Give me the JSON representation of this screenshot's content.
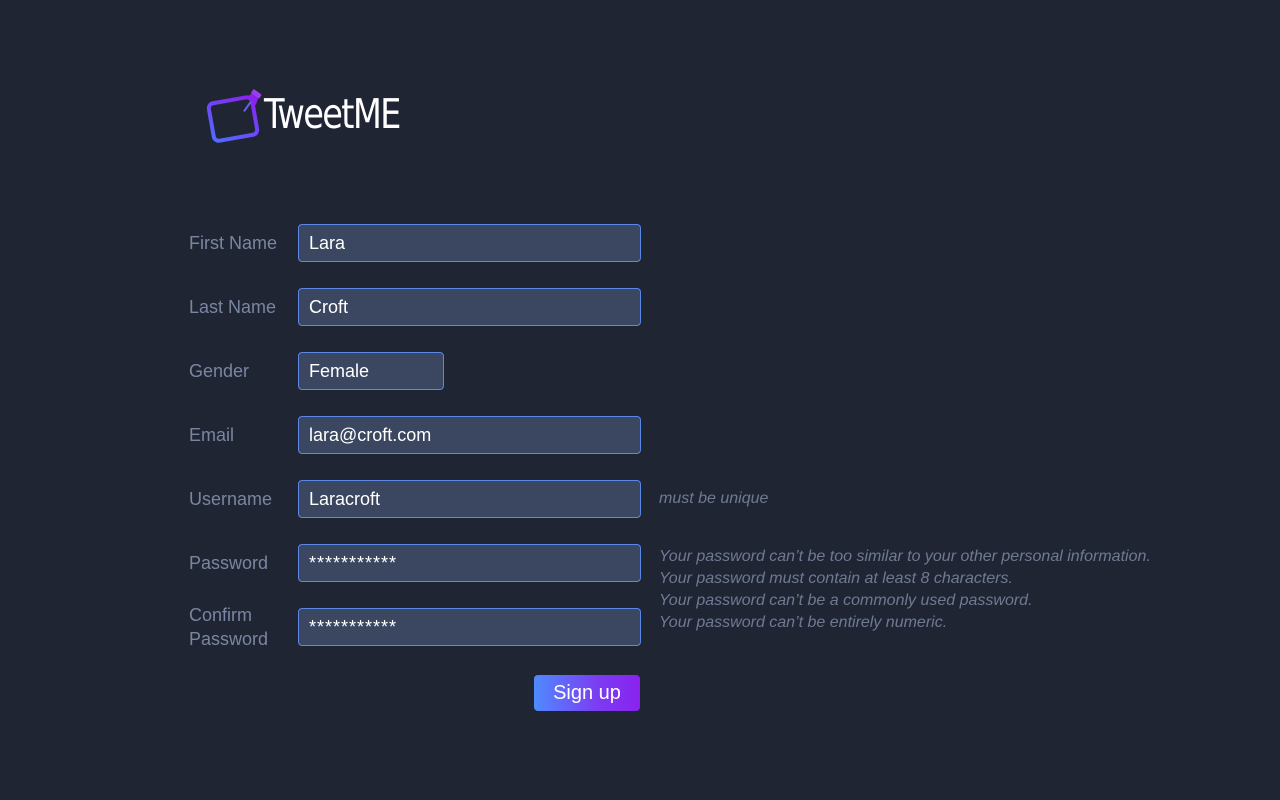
{
  "brand": {
    "name": "TweetME",
    "icon": "pin-tablet-icon",
    "gradient": [
      "#4f8bff",
      "#8a22f0"
    ]
  },
  "form": {
    "first_name": {
      "label": "First Name",
      "value": "Lara"
    },
    "last_name": {
      "label": "Last Name",
      "value": "Croft"
    },
    "gender": {
      "label": "Gender",
      "value": "Female"
    },
    "email": {
      "label": "Email",
      "value": "lara@croft.com"
    },
    "username": {
      "label": "Username",
      "value": "Laracroft",
      "hint": "must be unique"
    },
    "password": {
      "label": "Password",
      "value": "***********"
    },
    "confirm_password": {
      "label_line1": "Confirm",
      "label_line2": "Password",
      "value": "***********"
    },
    "password_hints": [
      "Your password can’t be too similar to your other personal information.",
      "Your password must contain at least 8 characters.",
      "Your password can’t be a commonly used password.",
      "Your password can’t be entirely numeric."
    ],
    "submit_label": "Sign up"
  },
  "colors": {
    "background": "#1f2533",
    "field_bg": "#3b4760",
    "field_border": "#5b87e6",
    "label": "#7a86a0",
    "hint": "#6f7a92"
  }
}
